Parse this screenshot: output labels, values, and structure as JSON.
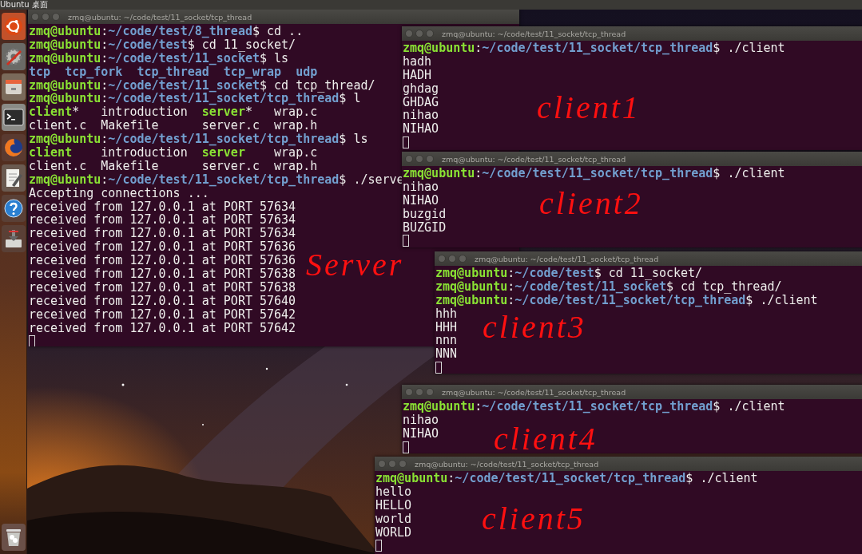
{
  "top_bar": {
    "title": "Ubuntu 桌面"
  },
  "launcher": {
    "items": [
      {
        "kind": "ubuntu"
      },
      {
        "kind": "settings"
      },
      {
        "kind": "files"
      },
      {
        "kind": "terminal"
      },
      {
        "kind": "firefox"
      },
      {
        "kind": "editor"
      },
      {
        "kind": "help"
      },
      {
        "kind": "updater"
      },
      {
        "kind": "trash"
      }
    ]
  },
  "windows": [
    {
      "title": "zmq@ubuntu: ~/code/test/11_socket/tcp_thread",
      "annotation": "Server",
      "lines": [
        [
          {
            "text": "zmq@ubuntu",
            "kind": "user"
          },
          {
            "text": ":",
            "kind": "plain"
          },
          {
            "text": "~/code/test/8_thread",
            "kind": "path"
          },
          {
            "text": "$ cd ..",
            "kind": "plain"
          }
        ],
        [
          {
            "text": "zmq@ubuntu",
            "kind": "user"
          },
          {
            "text": ":",
            "kind": "plain"
          },
          {
            "text": "~/code/test",
            "kind": "path"
          },
          {
            "text": "$ cd 11_socket/",
            "kind": "plain"
          }
        ],
        [
          {
            "text": "zmq@ubuntu",
            "kind": "user"
          },
          {
            "text": ":",
            "kind": "plain"
          },
          {
            "text": "~/code/test/11_socket",
            "kind": "path"
          },
          {
            "text": "$ ls",
            "kind": "plain"
          }
        ],
        [
          {
            "text": "tcp  tcp_fork  tcp_thread  tcp_wrap  udp",
            "kind": "dir"
          }
        ],
        [
          {
            "text": "zmq@ubuntu",
            "kind": "user"
          },
          {
            "text": ":",
            "kind": "plain"
          },
          {
            "text": "~/code/test/11_socket",
            "kind": "path"
          },
          {
            "text": "$ cd tcp_thread/",
            "kind": "plain"
          }
        ],
        [
          {
            "text": "zmq@ubuntu",
            "kind": "user"
          },
          {
            "text": ":",
            "kind": "plain"
          },
          {
            "text": "~/code/test/11_socket/tcp_thread",
            "kind": "path"
          },
          {
            "text": "$ l",
            "kind": "plain"
          }
        ],
        [
          {
            "text": "client",
            "kind": "exec"
          },
          {
            "text": "*   introduction  ",
            "kind": "plain"
          },
          {
            "text": "server",
            "kind": "exec"
          },
          {
            "text": "*   wrap.c",
            "kind": "plain"
          }
        ],
        [
          {
            "text": "client.c  Makefile      server.c  wrap.h",
            "kind": "plain"
          }
        ],
        [
          {
            "text": "zmq@ubuntu",
            "kind": "user"
          },
          {
            "text": ":",
            "kind": "plain"
          },
          {
            "text": "~/code/test/11_socket/tcp_thread",
            "kind": "path"
          },
          {
            "text": "$ ls",
            "kind": "plain"
          }
        ],
        [
          {
            "text": "client",
            "kind": "exec"
          },
          {
            "text": "    introduction  ",
            "kind": "plain"
          },
          {
            "text": "server",
            "kind": "exec"
          },
          {
            "text": "    wrap.c",
            "kind": "plain"
          }
        ],
        [
          {
            "text": "client.c  Makefile      server.c  wrap.h",
            "kind": "plain"
          }
        ],
        [
          {
            "text": "zmq@ubuntu",
            "kind": "user"
          },
          {
            "text": ":",
            "kind": "plain"
          },
          {
            "text": "~/code/test/11_socket/tcp_thread",
            "kind": "path"
          },
          {
            "text": "$ ./serve",
            "kind": "plain"
          }
        ],
        [
          {
            "text": "Accepting connections ...",
            "kind": "plain"
          }
        ],
        [
          {
            "text": "received from 127.0.0.1 at PORT 57634",
            "kind": "plain"
          }
        ],
        [
          {
            "text": "received from 127.0.0.1 at PORT 57634",
            "kind": "plain"
          }
        ],
        [
          {
            "text": "received from 127.0.0.1 at PORT 57634",
            "kind": "plain"
          }
        ],
        [
          {
            "text": "received from 127.0.0.1 at PORT 57636",
            "kind": "plain"
          }
        ],
        [
          {
            "text": "received from 127.0.0.1 at PORT 57636",
            "kind": "plain"
          }
        ],
        [
          {
            "text": "received from 127.0.0.1 at PORT 57638",
            "kind": "plain"
          }
        ],
        [
          {
            "text": "received from 127.0.0.1 at PORT 57638",
            "kind": "plain"
          }
        ],
        [
          {
            "text": "received from 127.0.0.1 at PORT 57640",
            "kind": "plain"
          }
        ],
        [
          {
            "text": "received from 127.0.0.1 at PORT 57642",
            "kind": "plain"
          }
        ],
        [
          {
            "text": "received from 127.0.0.1 at PORT 57642",
            "kind": "plain"
          }
        ]
      ]
    },
    {
      "title": "zmq@ubuntu: ~/code/test/11_socket/tcp_thread",
      "annotation": "client1",
      "lines": [
        [
          {
            "text": "zmq@ubuntu",
            "kind": "user"
          },
          {
            "text": ":",
            "kind": "plain"
          },
          {
            "text": "~/code/test/11_socket/tcp_thread",
            "kind": "path"
          },
          {
            "text": "$ ./client",
            "kind": "plain"
          }
        ],
        [
          {
            "text": "hadh",
            "kind": "plain"
          }
        ],
        [
          {
            "text": "HADH",
            "kind": "plain"
          }
        ],
        [
          {
            "text": "ghdag",
            "kind": "plain"
          }
        ],
        [
          {
            "text": "GHDAG",
            "kind": "plain"
          }
        ],
        [
          {
            "text": "nihao",
            "kind": "plain"
          }
        ],
        [
          {
            "text": "NIHAO",
            "kind": "plain"
          }
        ]
      ]
    },
    {
      "title": "zmq@ubuntu: ~/code/test/11_socket/tcp_thread",
      "annotation": "client2",
      "lines": [
        [
          {
            "text": "zmq@ubuntu",
            "kind": "user"
          },
          {
            "text": ":",
            "kind": "plain"
          },
          {
            "text": "~/code/test/11_socket/tcp_thread",
            "kind": "path"
          },
          {
            "text": "$ ./client",
            "kind": "plain"
          }
        ],
        [
          {
            "text": "nihao",
            "kind": "plain"
          }
        ],
        [
          {
            "text": "NIHAO",
            "kind": "plain"
          }
        ],
        [
          {
            "text": "buzgid",
            "kind": "plain"
          }
        ],
        [
          {
            "text": "BUZGID",
            "kind": "plain"
          }
        ]
      ]
    },
    {
      "title": "zmq@ubuntu: ~/code/test/11_socket/tcp_thread",
      "annotation": "client3",
      "lines": [
        [
          {
            "text": "zmq@ubuntu",
            "kind": "user"
          },
          {
            "text": ":",
            "kind": "plain"
          },
          {
            "text": "~/code/test",
            "kind": "path"
          },
          {
            "text": "$ cd 11_socket/",
            "kind": "plain"
          }
        ],
        [
          {
            "text": "zmq@ubuntu",
            "kind": "user"
          },
          {
            "text": ":",
            "kind": "plain"
          },
          {
            "text": "~/code/test/11_socket",
            "kind": "path"
          },
          {
            "text": "$ cd tcp_thread/",
            "kind": "plain"
          }
        ],
        [
          {
            "text": "zmq@ubuntu",
            "kind": "user"
          },
          {
            "text": ":",
            "kind": "plain"
          },
          {
            "text": "~/code/test/11_socket/tcp_thread",
            "kind": "path"
          },
          {
            "text": "$ ./client",
            "kind": "plain"
          }
        ],
        [
          {
            "text": "hhh",
            "kind": "plain"
          }
        ],
        [
          {
            "text": "HHH",
            "kind": "plain"
          }
        ],
        [
          {
            "text": "nnn",
            "kind": "plain"
          }
        ],
        [
          {
            "text": "NNN",
            "kind": "plain"
          }
        ]
      ]
    },
    {
      "title": "zmq@ubuntu: ~/code/test/11_socket/tcp_thread",
      "annotation": "client4",
      "lines": [
        [
          {
            "text": "zmq@ubuntu",
            "kind": "user"
          },
          {
            "text": ":",
            "kind": "plain"
          },
          {
            "text": "~/code/test/11_socket/tcp_thread",
            "kind": "path"
          },
          {
            "text": "$ ./client",
            "kind": "plain"
          }
        ],
        [
          {
            "text": "nihao",
            "kind": "plain"
          }
        ],
        [
          {
            "text": "NIHAO",
            "kind": "plain"
          }
        ]
      ]
    },
    {
      "title": "zmq@ubuntu: ~/code/test/11_socket/tcp_thread",
      "annotation": "client5",
      "lines": [
        [
          {
            "text": "zmq@ubuntu",
            "kind": "user"
          },
          {
            "text": ":",
            "kind": "plain"
          },
          {
            "text": "~/code/test/11_socket/tcp_thread",
            "kind": "path"
          },
          {
            "text": "$ ./client",
            "kind": "plain"
          }
        ],
        [
          {
            "text": "hello",
            "kind": "plain"
          }
        ],
        [
          {
            "text": "HELLO",
            "kind": "plain"
          }
        ],
        [
          {
            "text": "world",
            "kind": "plain"
          }
        ],
        [
          {
            "text": "WORLD",
            "kind": "plain"
          }
        ]
      ]
    }
  ]
}
